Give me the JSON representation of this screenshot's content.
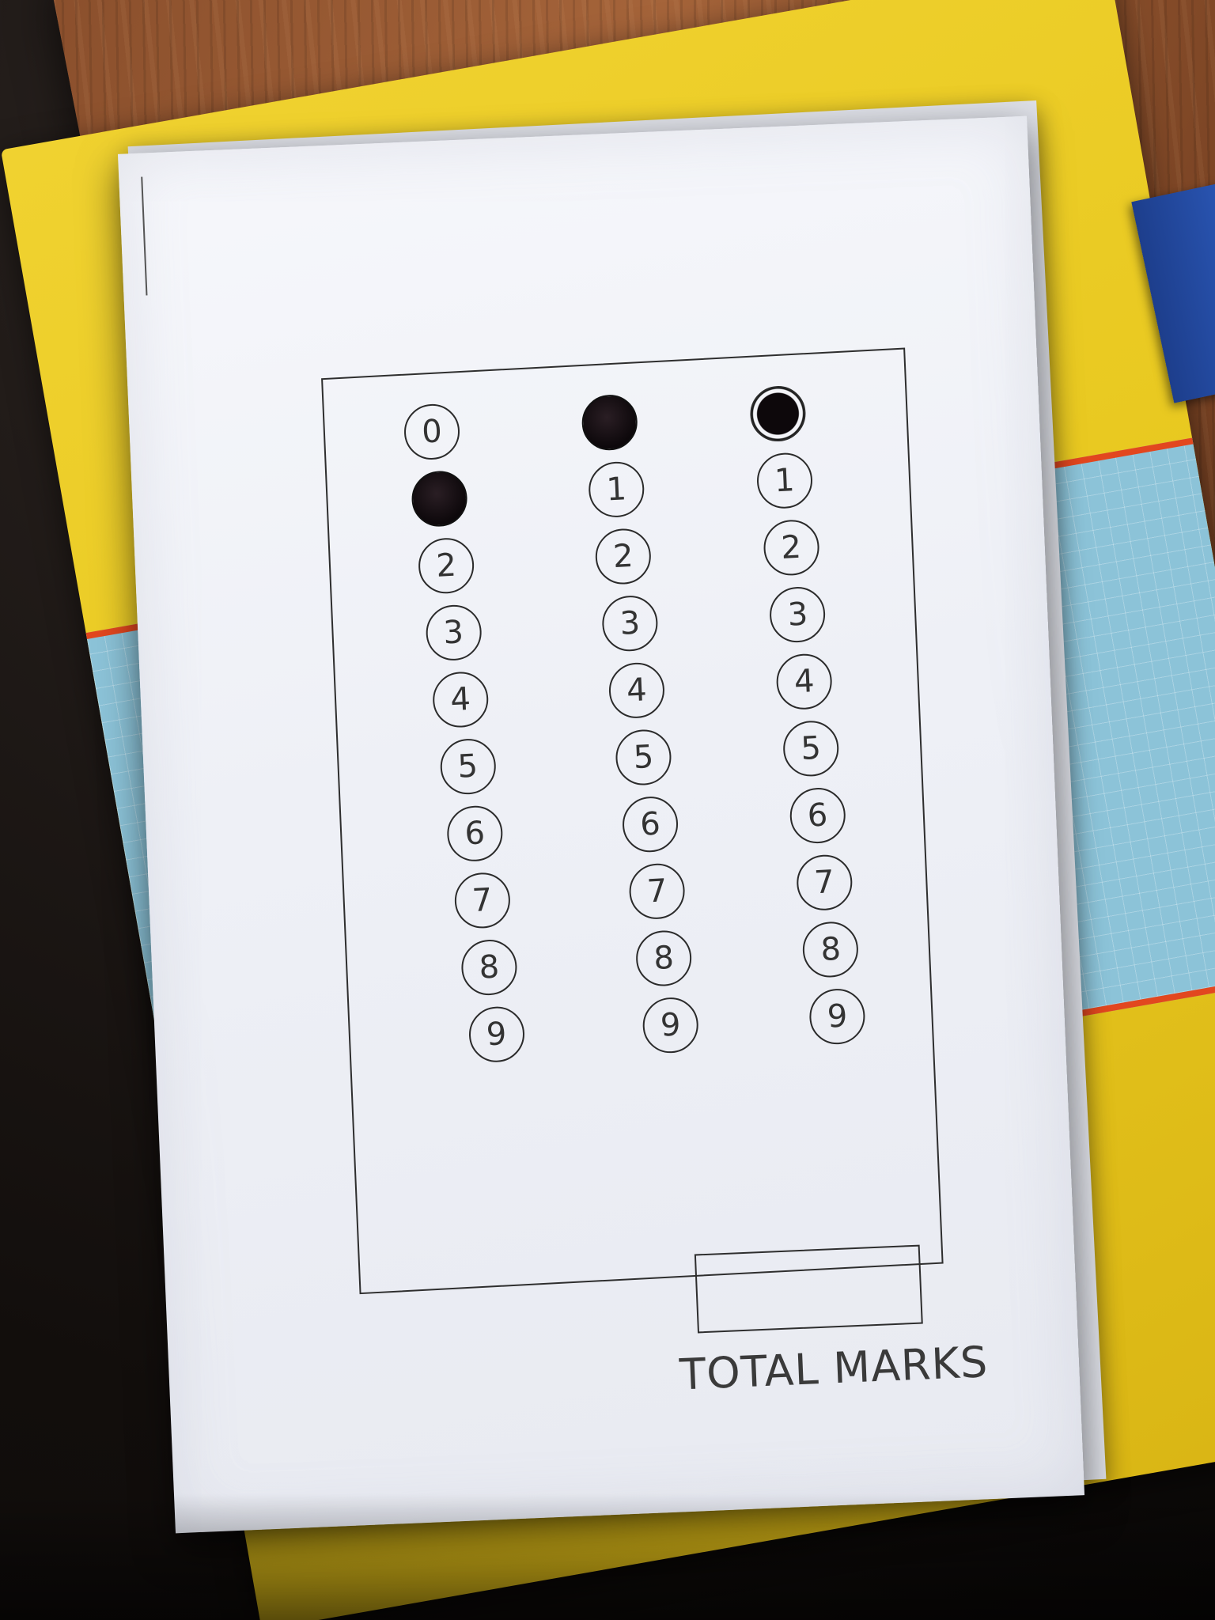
{
  "sheet": {
    "columns": [
      {
        "digits": [
          "0",
          "1",
          "2",
          "3",
          "4",
          "5",
          "6",
          "7",
          "8",
          "9"
        ],
        "marked": "1"
      },
      {
        "digits": [
          "0",
          "1",
          "2",
          "3",
          "4",
          "5",
          "6",
          "7",
          "8",
          "9"
        ],
        "marked": "0"
      },
      {
        "digits": [
          "0",
          "1",
          "2",
          "3",
          "4",
          "5",
          "6",
          "7",
          "8",
          "9"
        ],
        "marked": "0"
      }
    ],
    "total_label": "TOTAL MARKS",
    "total_value": ""
  },
  "colors": {
    "paper": "#eef0f6",
    "ink": "#2b2b2b",
    "fill": "#0d080b",
    "desk": "#a5643a",
    "notebook": "#e8c81f",
    "notebook_grid": "#8cc3d8",
    "notebook_stripe": "#e2471f"
  }
}
